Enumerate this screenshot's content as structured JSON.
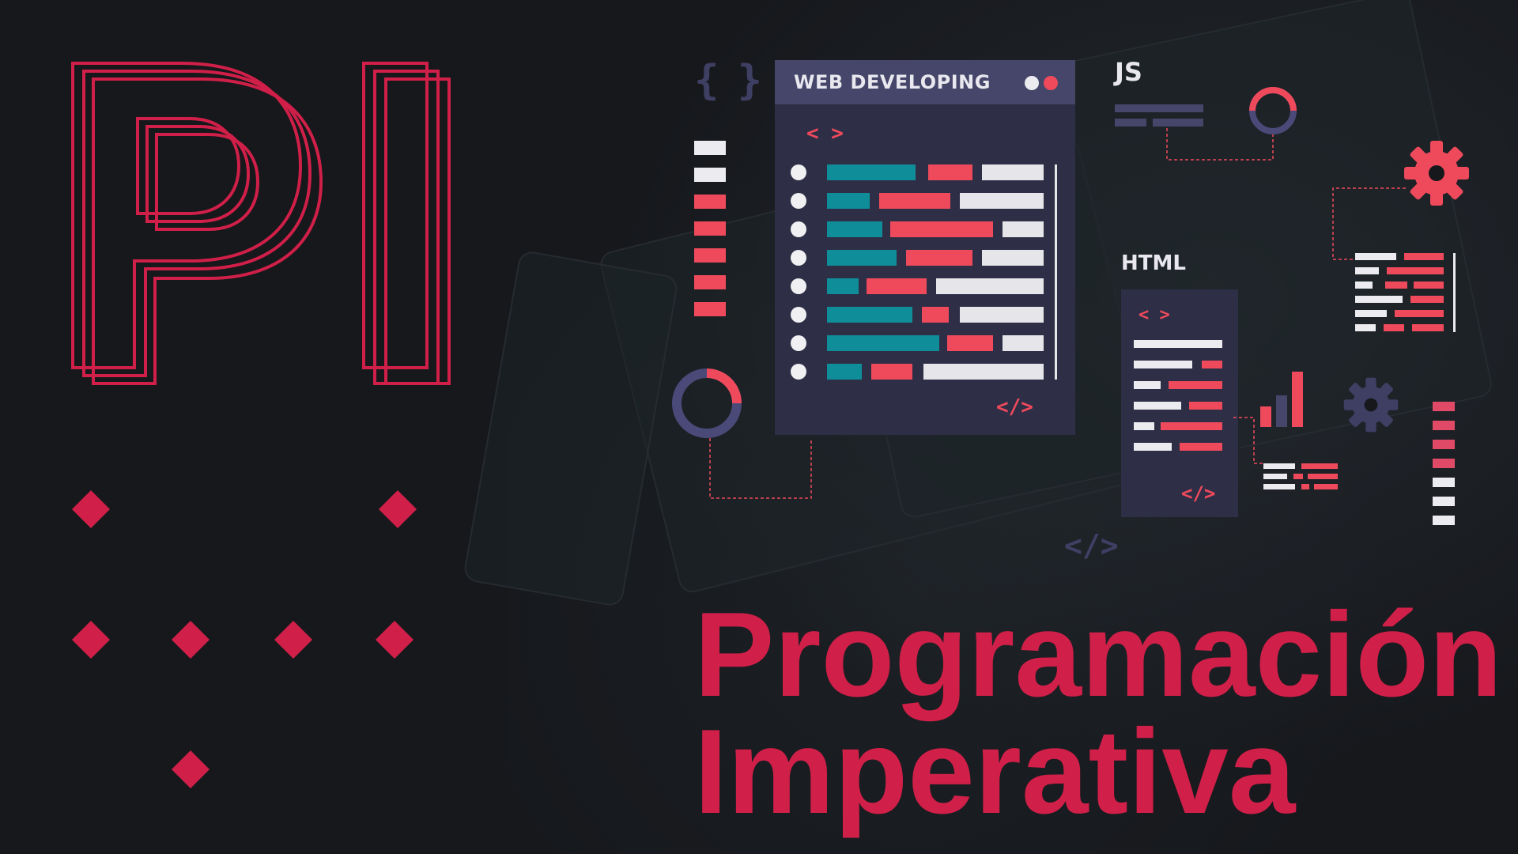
{
  "hero": {
    "monogram": "PI",
    "title_line1": "Programación",
    "title_line2": "Imperativa"
  },
  "illustration": {
    "window_title": "WEB DEVELOPING",
    "open_tag": "< >",
    "close_tag": "</>",
    "braces": "{ }",
    "js_label": "JS",
    "html_label": "HTML",
    "html_open_tag": "< >",
    "html_close_tag": "</>",
    "floating_close_tag": "</>"
  },
  "colors": {
    "accent": "#d01f48",
    "coral": "#ef4a5c",
    "teal": "#0f8e9a",
    "panel": "#32324a",
    "background": "#16181c"
  }
}
